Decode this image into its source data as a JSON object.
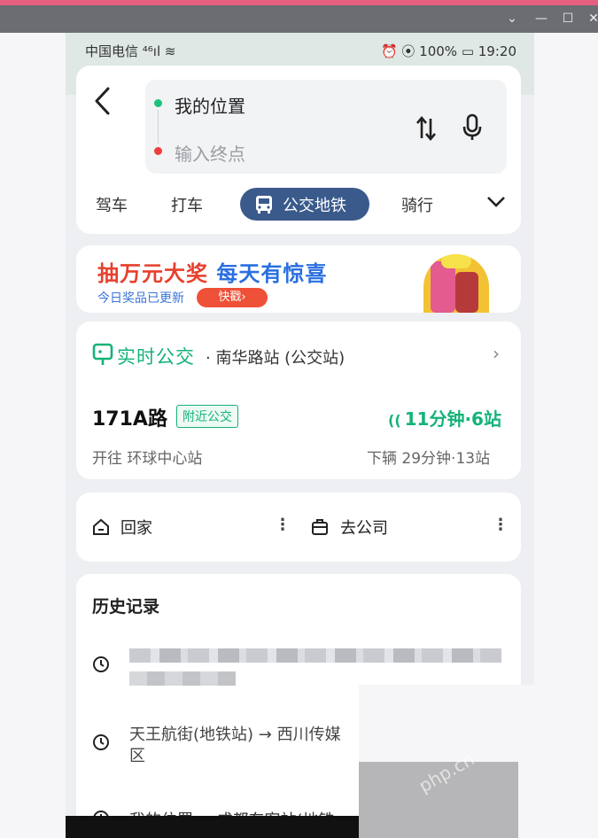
{
  "window": {
    "controls": [
      "⌄",
      "▭",
      "☐",
      "✕"
    ]
  },
  "status_bar": {
    "carrier": "中国电信 ⁴⁶ıl ≋",
    "right": "⏰ ⦿ 100% ▭ 19:20"
  },
  "search": {
    "start": "我的位置",
    "end_placeholder": "输入终点"
  },
  "modes": {
    "drive": "驾车",
    "taxi": "打车",
    "transit": "公交地铁",
    "bike": "骑行"
  },
  "banner": {
    "title_red_1": "抽万元大奖 ",
    "title_blue": "每天有惊喜",
    "subtitle": "今日奖品已更新",
    "button": "快戳›"
  },
  "realtime_bus": {
    "label": "实时公交",
    "stop": "· 南华路站 (公交站)",
    "route": "171A路",
    "badge": "附近公交",
    "eta": "11分钟·6站",
    "direction": "开往 环球中心站",
    "next": "下辆 29分钟·13站"
  },
  "places": {
    "home": "回家",
    "company": "去公司"
  },
  "history": {
    "title": "历史记录",
    "item2": "天王航街(地铁站) → 西川传媒区",
    "item2_line1": "天王航街(地铁站) → 西川传媒",
    "item2_line2": "区",
    "item3": "我的位置 → 成都东客站(地铁"
  },
  "watermark": "php.cn",
  "colors": {
    "accent_green": "#14b378",
    "transit_blue": "#3a5a8c",
    "banner_red": "#e8402d",
    "banner_blue": "#2a6fe0"
  }
}
